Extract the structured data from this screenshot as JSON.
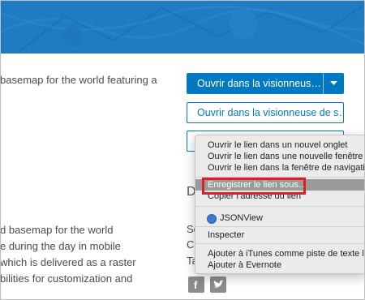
{
  "page": {
    "body_lines_top": [
      "basemap for the world featuring a"
    ],
    "body_lines_bottom": [
      "d basemap for the world",
      "e during the day in mobile",
      "which is delivered as a raster",
      "bilities for customization and"
    ],
    "primary_button": "Ouvrir dans la visionneus…",
    "secondary_button": "Ouvrir dans la visionneuse de s…",
    "side_heading_fragment": "D",
    "side_fragments": [
      "Sc",
      "Cr",
      "Ta"
    ],
    "social_icons": [
      "facebook-icon",
      "twitter-icon"
    ]
  },
  "context_menu": {
    "items": [
      "Ouvrir le lien dans un nouvel onglet",
      "Ouvrir le lien dans une nouvelle fenêtre",
      "Ouvrir le lien dans la fenêtre de navigation",
      "Enregistrer le lien sous…",
      "Copier l’adresse du lien",
      "JSONView",
      "Inspecter",
      "Ajouter à iTunes comme piste de texte lu",
      "Ajouter à Evernote"
    ],
    "highlighted": "Enregistrer le lien sous…"
  },
  "colors": {
    "banner": "#1f7cc2",
    "accent": "#0079c1",
    "highlight": "#9a9a9a",
    "callout": "#e31b23"
  }
}
